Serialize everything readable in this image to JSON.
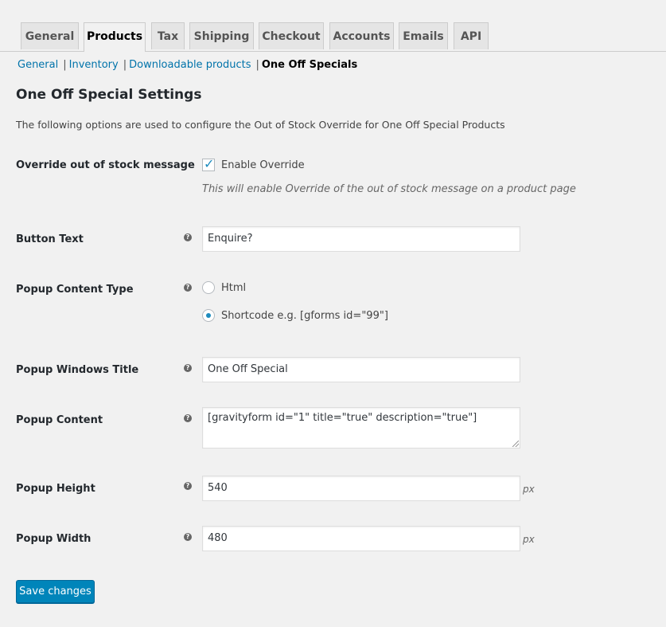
{
  "tabs": [
    {
      "label": "General"
    },
    {
      "label": "Products"
    },
    {
      "label": "Tax"
    },
    {
      "label": "Shipping"
    },
    {
      "label": "Checkout"
    },
    {
      "label": "Accounts"
    },
    {
      "label": "Emails"
    },
    {
      "label": "API"
    }
  ],
  "subnav": {
    "items": [
      "General",
      "Inventory",
      "Downloadable products"
    ],
    "current": "One Off Specials"
  },
  "page": {
    "title": "One Off Special Settings",
    "description": "The following options are used to configure the Out of Stock Override for One Off Special Products"
  },
  "fields": {
    "override": {
      "label": "Override out of stock message",
      "checkbox_label": "Enable Override",
      "checked": true,
      "help": "This will enable Override of the out of stock message on a product page"
    },
    "button_text": {
      "label": "Button Text",
      "value": "Enquire?"
    },
    "content_type": {
      "label": "Popup Content Type",
      "options": [
        "Html",
        "Shortcode e.g. [gforms id=\"99\"]"
      ],
      "selected": "Shortcode e.g. [gforms id=\"99\"]"
    },
    "window_title": {
      "label": "Popup Windows Title",
      "value": "One Off Special"
    },
    "content": {
      "label": "Popup Content",
      "value": "[gravityform id=\"1\" title=\"true\" description=\"true\"]"
    },
    "height": {
      "label": "Popup Height",
      "value": "540",
      "unit": "px"
    },
    "width": {
      "label": "Popup Width",
      "value": "480",
      "unit": "px"
    }
  },
  "save_label": "Save changes",
  "colors": {
    "accent": "#0085ba",
    "link": "#0073aa"
  }
}
